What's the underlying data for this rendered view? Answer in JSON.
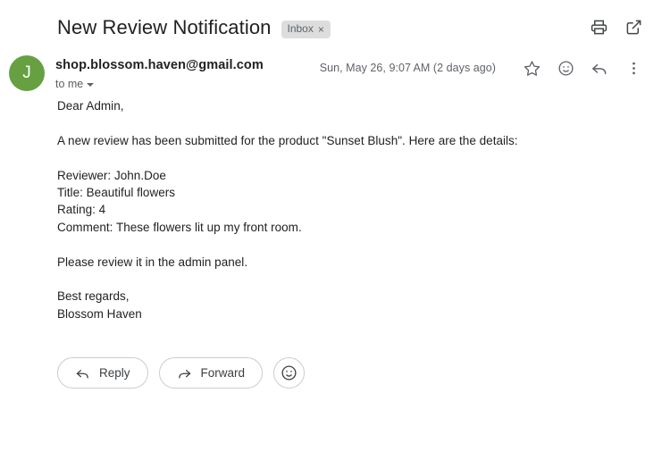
{
  "header": {
    "subject": "New Review Notification",
    "label_chip": {
      "text": "Inbox",
      "close": "×"
    },
    "icons": [
      {
        "name": "print-icon",
        "label": "Print"
      },
      {
        "name": "open-in-new-icon",
        "label": "Open in new window"
      }
    ]
  },
  "sender": {
    "avatar_initial": "J",
    "avatar_color": "#67a041",
    "email": "shop.blossom.haven@gmail.com",
    "recipient": "to me",
    "timestamp": "Sun, May 26, 9:07 AM (2 days ago)",
    "icons": [
      {
        "name": "star-icon",
        "label": "Star"
      },
      {
        "name": "emoji-icon",
        "label": "Add reaction"
      },
      {
        "name": "reply-icon",
        "label": "Reply"
      },
      {
        "name": "more-options-icon",
        "label": "More"
      }
    ]
  },
  "body": {
    "lines": [
      "Dear Admin,",
      "",
      "A new review has been submitted for the product \"Sunset Blush\". Here are the details:",
      "",
      "Reviewer: John.Doe",
      "Title: Beautiful flowers",
      "Rating: 4",
      "Comment: These flowers lit up my front room.",
      "",
      "Please review it in the admin panel.",
      "",
      "Best regards,",
      "Blossom Haven"
    ]
  },
  "actions": {
    "reply_label": "Reply",
    "forward_label": "Forward",
    "emoji_label": ""
  }
}
